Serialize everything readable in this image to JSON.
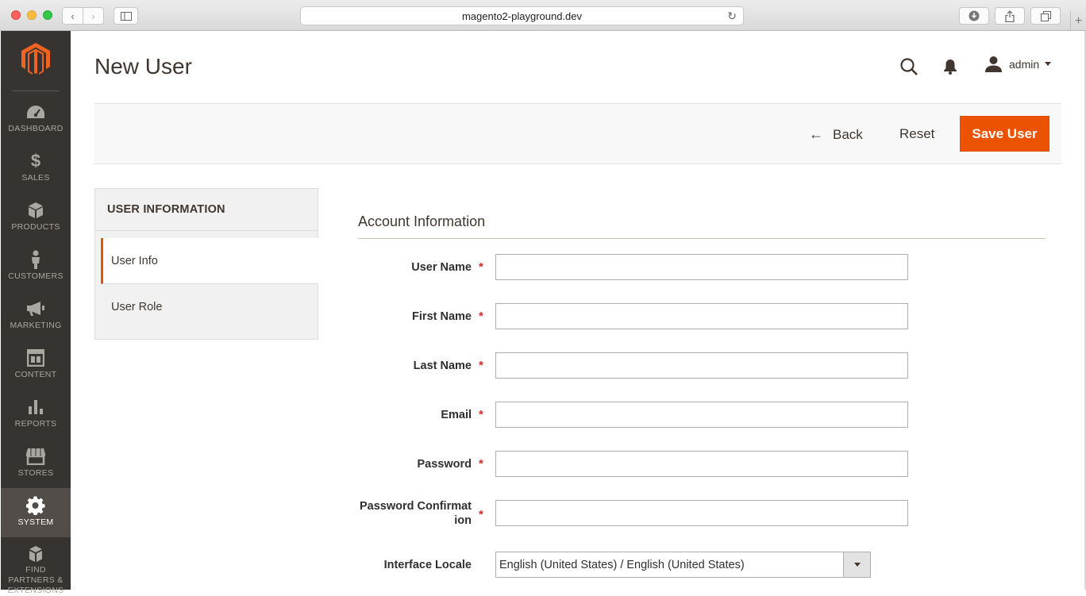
{
  "browser": {
    "url": "magento2-playground.dev",
    "new_tab": "+"
  },
  "sidebar": {
    "items": [
      {
        "label": "DASHBOARD",
        "icon": "dashboard-icon"
      },
      {
        "label": "SALES",
        "icon": "dollar-icon"
      },
      {
        "label": "PRODUCTS",
        "icon": "box-icon"
      },
      {
        "label": "CUSTOMERS",
        "icon": "person-icon"
      },
      {
        "label": "MARKETING",
        "icon": "megaphone-icon"
      },
      {
        "label": "CONTENT",
        "icon": "layout-icon"
      },
      {
        "label": "REPORTS",
        "icon": "bar-chart-icon"
      },
      {
        "label": "STORES",
        "icon": "storefront-icon"
      },
      {
        "label": "SYSTEM",
        "icon": "gear-icon",
        "active": true
      },
      {
        "label": "FIND PARTNERS & EXTENSIONS",
        "icon": "blocks-icon"
      }
    ]
  },
  "header": {
    "title": "New User",
    "user": "admin"
  },
  "actions": {
    "back": "Back",
    "reset": "Reset",
    "save": "Save User"
  },
  "tabs": {
    "title": "USER INFORMATION",
    "items": [
      {
        "label": "User Info",
        "active": true
      },
      {
        "label": "User Role",
        "active": false
      }
    ]
  },
  "form": {
    "section_title": "Account Information",
    "required_mark": "*",
    "fields": [
      {
        "label": "User Name",
        "value": ""
      },
      {
        "label": "First Name",
        "value": ""
      },
      {
        "label": "Last Name",
        "value": ""
      },
      {
        "label": "Email",
        "value": ""
      },
      {
        "label": "Password",
        "value": ""
      },
      {
        "label": "Password Confirmation",
        "value": ""
      }
    ],
    "locale": {
      "label": "Interface Locale",
      "value": "English (United States) / English (United States)"
    }
  },
  "colors": {
    "accent": "#eb5202",
    "sidebar": "#373330",
    "sidebar_active": "#524d49"
  }
}
